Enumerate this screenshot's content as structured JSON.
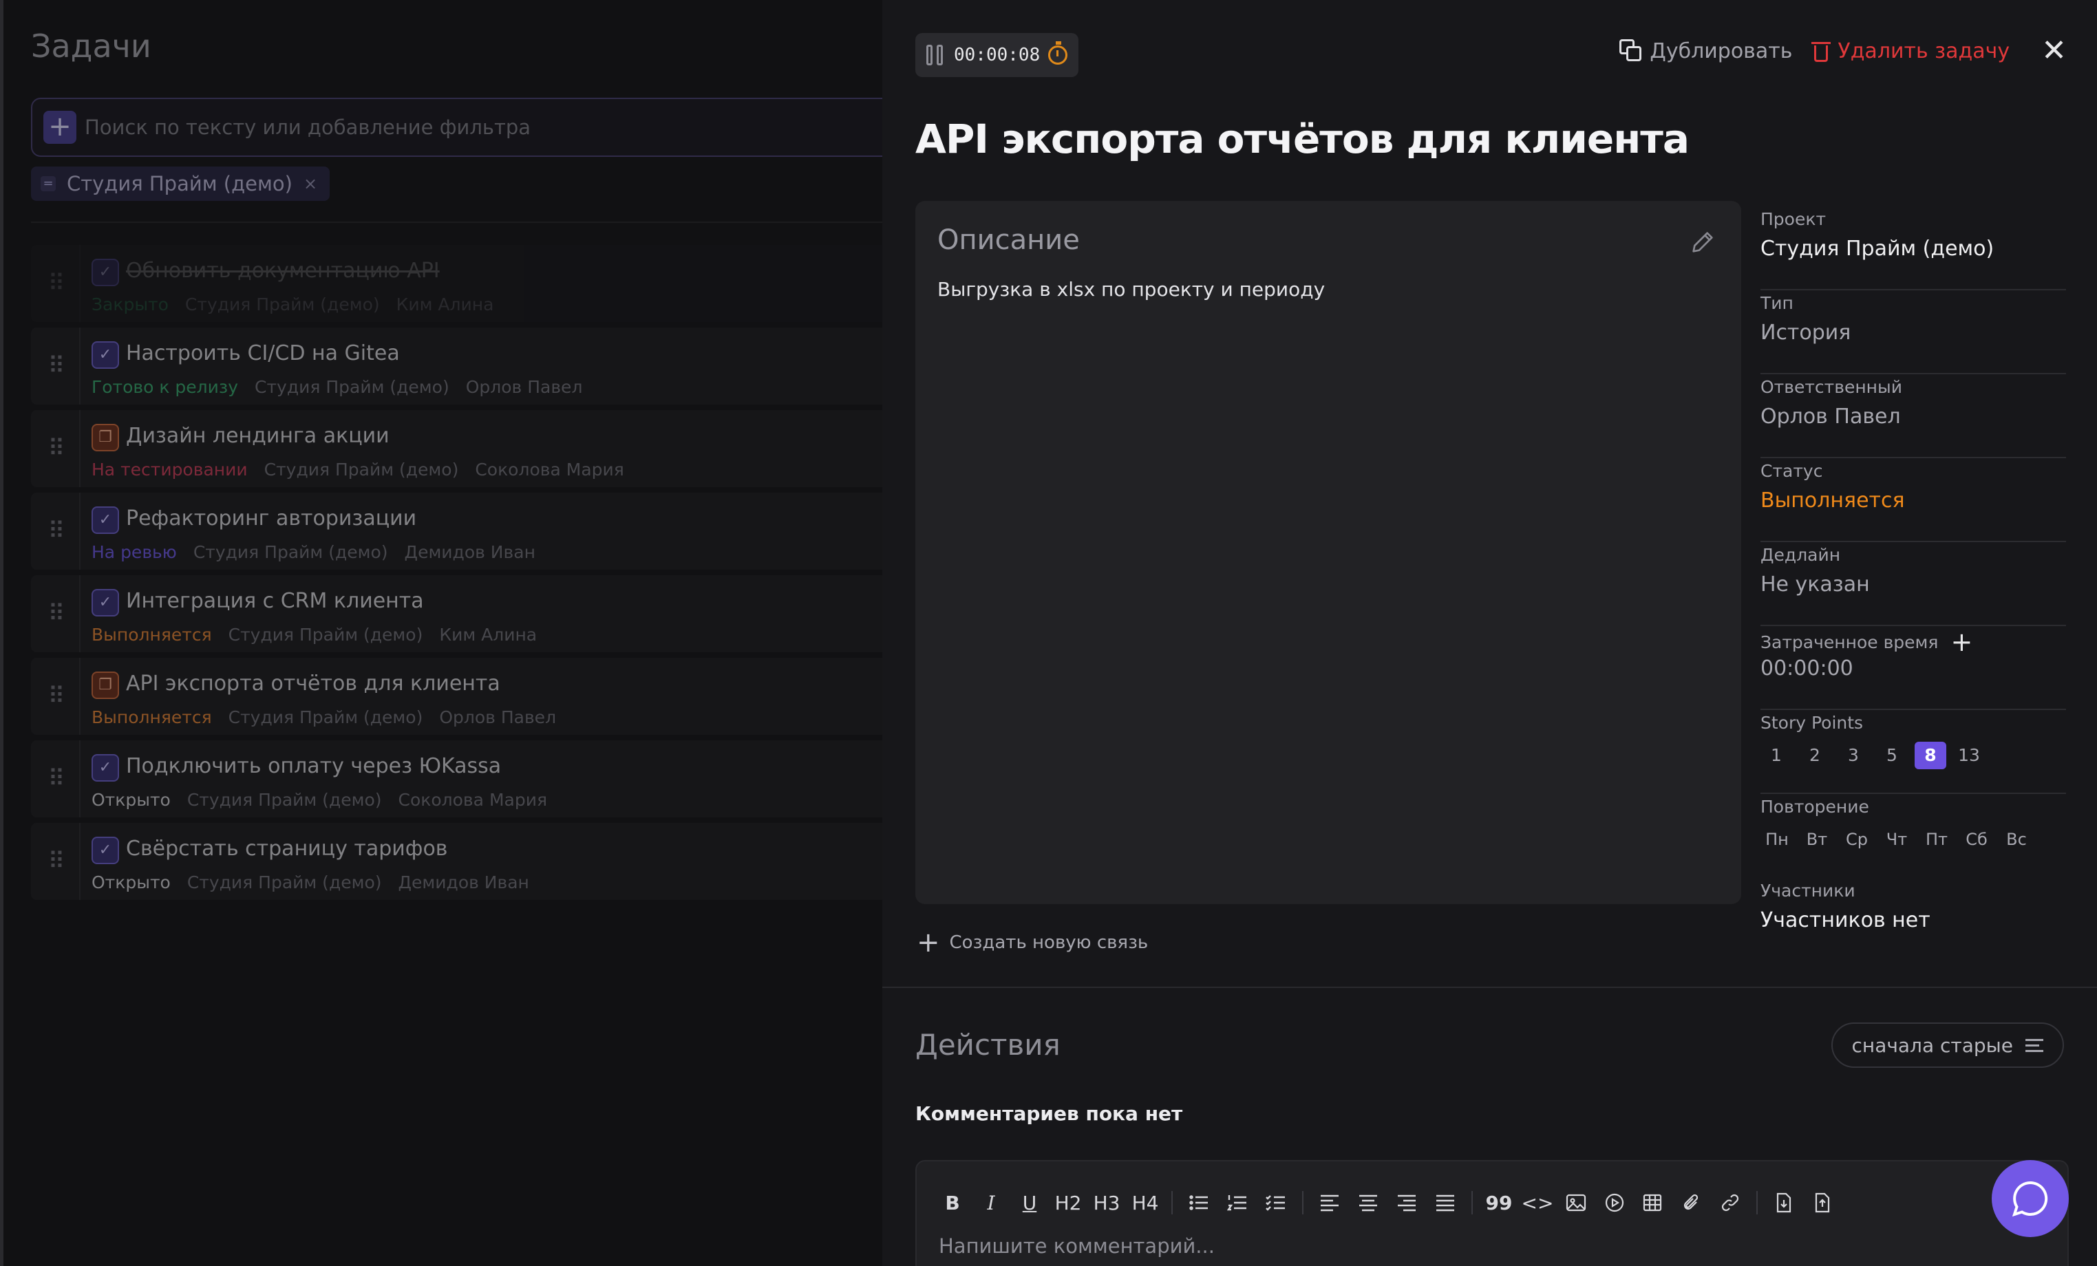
{
  "left": {
    "title": "Задачи",
    "search_placeholder": "Поиск по тексту или добавление фильтра",
    "filter_chip": {
      "label": "Студия Прайм (демо)",
      "eq": "=",
      "remove": "×"
    },
    "tasks": [
      {
        "title": "Обновить документацию API",
        "status": "Закрыто",
        "project": "Студия Прайм (демо)",
        "assignee": "Ким Алина"
      },
      {
        "title": "Настроить CI/CD на Gitea",
        "status": "Готово к релизу",
        "project": "Студия Прайм (демо)",
        "assignee": "Орлов Павел"
      },
      {
        "title": "Дизайн лендинга акции",
        "status": "На тестировании",
        "project": "Студия Прайм (демо)",
        "assignee": "Соколова Мария"
      },
      {
        "title": "Рефакторинг авторизации",
        "status": "На ревью",
        "project": "Студия Прайм (демо)",
        "assignee": "Демидов Иван"
      },
      {
        "title": "Интеграция с CRM клиента",
        "status": "Выполняется",
        "project": "Студия Прайм (демо)",
        "assignee": "Ким Алина"
      },
      {
        "title": "API экспорта отчётов для клиента",
        "status": "Выполняется",
        "project": "Студия Прайм (демо)",
        "assignee": "Орлов Павел"
      },
      {
        "title": "Подключить оплату через ЮKassa",
        "status": "Открыто",
        "project": "Студия Прайм (демо)",
        "assignee": "Соколова Мария"
      },
      {
        "title": "Свёрстать страницу тарифов",
        "status": "Открыто",
        "project": "Студия Прайм (демо)",
        "assignee": "Демидов Иван"
      }
    ]
  },
  "detail": {
    "timer": "00:00:08",
    "duplicate_label": "Дублировать",
    "delete_label": "Удалить задачу",
    "close_icon": "✕",
    "title": "API экспорта отчётов для клиента",
    "description": {
      "heading": "Описание",
      "text": "Выгрузка в xlsx по проекту и периоду"
    },
    "create_link_label": "Создать новую связь",
    "props": {
      "project": {
        "label": "Проект",
        "value": "Студия Прайм (демо)"
      },
      "type": {
        "label": "Тип",
        "value": "История"
      },
      "assignee": {
        "label": "Ответственный",
        "value": "Орлов Павел"
      },
      "status": {
        "label": "Статус",
        "value": "Выполняется"
      },
      "deadline": {
        "label": "Дедлайн",
        "value": "Не указан"
      },
      "time_spent": {
        "label": "Затраченное время",
        "value": "00:00:00"
      },
      "story_points": {
        "label": "Story Points",
        "options": [
          "1",
          "2",
          "3",
          "5",
          "8",
          "13"
        ],
        "selected": "8"
      },
      "repeat": {
        "label": "Повторение",
        "days": [
          "Пн",
          "Вт",
          "Ср",
          "Чт",
          "Пт",
          "Сб",
          "Вс"
        ]
      },
      "participants": {
        "label": "Участники",
        "value": "Участников нет"
      }
    },
    "actions": {
      "heading": "Действия",
      "sort_label": "сначала старые",
      "empty": "Комментариев пока нет",
      "comment_placeholder": "Напишите комментарий..."
    },
    "toolbar": {
      "bold": "B",
      "italic": "I",
      "underline": "U",
      "h2": "H2",
      "h3": "H3",
      "h4": "H4",
      "quote": "99",
      "code": "<>"
    }
  },
  "colors": {
    "accent": "#6b50e0",
    "status_in_progress": "#f08a1a",
    "danger": "#e0383a",
    "status_ready": "#3aa06c",
    "status_testing": "#c0405a",
    "status_review": "#6a58d8"
  }
}
